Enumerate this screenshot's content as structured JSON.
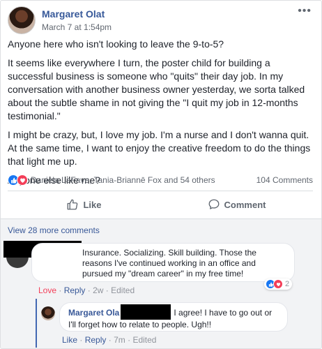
{
  "post": {
    "author": "Margaret Olat",
    "time": "March 7 at 1:54pm",
    "more": "•••",
    "paragraphs": [
      "Anyone here who isn't looking to leave the 9-to-5?",
      "It seems like everywhere I turn, the poster child for building a successful business is someone who \"quits\" their day job. In my conversation with another business owner yesterday, we sorta talked about the subtle shame in not giving the \"I quit my job in 12-months testimonial.\"",
      "I might be crazy, but, I love my job. I'm a nurse and I don't wanna quit. At the same time, I want to enjoy the creative freedom to do the things that light me up.",
      "Anyone else like me?"
    ]
  },
  "reactions": {
    "icons": [
      "like-icon",
      "love-icon"
    ],
    "names": "Daniela LaFave, Tania-Briannē Fox and 54 others",
    "comment_count": "104 Comments"
  },
  "actions": {
    "like_label": "Like",
    "comment_label": "Comment"
  },
  "comments": {
    "view_more": "View 28 more comments",
    "first": {
      "text": "Insurance. Socializing. Skill building. Those the reasons I've continued working in an office and pursued my \"dream career\" in my free time!",
      "love": "Love",
      "reply": "Reply",
      "time": "2w",
      "edited": "Edited",
      "reaction_count": "2"
    },
    "reply": {
      "author": "Margaret Ola",
      "text": "I agree! I have to go out or I'll forget how to relate to people. Ugh!!",
      "like": "Like",
      "reply": "Reply",
      "time": "7m",
      "edited": "Edited"
    },
    "separator": "·"
  }
}
